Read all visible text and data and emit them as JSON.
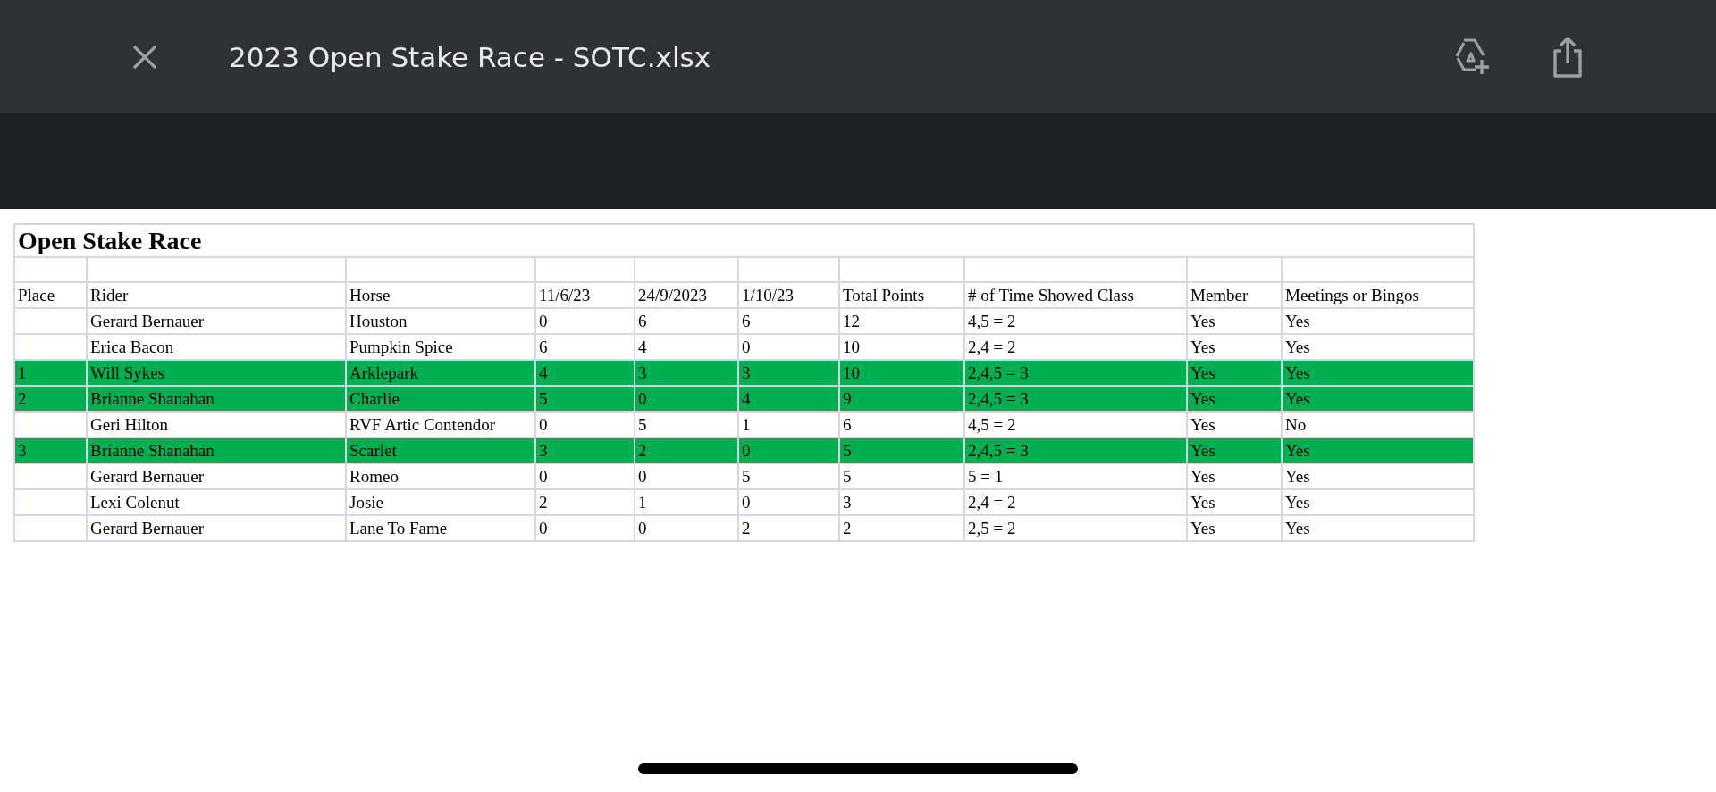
{
  "app_bar": {
    "title": "2023 Open Stake Race - SOTC.xlsx"
  },
  "sheet": {
    "title": "Open Stake Race",
    "columns": [
      "Place",
      "Rider",
      "Horse",
      "11/6/23",
      "24/9/2023",
      "1/10/23",
      "Total Points",
      "# of Time Showed Class",
      "Member",
      "Meetings or Bingos"
    ],
    "rows": [
      {
        "highlighted": false,
        "cells": [
          "",
          "Gerard Bernauer",
          "Houston",
          "0",
          "6",
          "6",
          "12",
          "4,5 = 2",
          "Yes",
          "Yes"
        ]
      },
      {
        "highlighted": false,
        "cells": [
          "",
          "Erica Bacon",
          "Pumpkin Spice",
          "6",
          "4",
          "0",
          "10",
          "2,4 = 2",
          "Yes",
          "Yes"
        ]
      },
      {
        "highlighted": true,
        "cells": [
          "1",
          "Will Sykes",
          "Arklepark",
          "4",
          "3",
          "3",
          "10",
          "2,4,5 = 3",
          "Yes",
          "Yes"
        ]
      },
      {
        "highlighted": true,
        "cells": [
          "2",
          "Brianne Shanahan",
          "Charlie",
          "5",
          "0",
          "4",
          "9",
          "2,4,5 = 3",
          "Yes",
          "Yes"
        ]
      },
      {
        "highlighted": false,
        "cells": [
          "",
          "Geri Hilton",
          "RVF Artic Contendor",
          "0",
          "5",
          "1",
          "6",
          "4,5 = 2",
          "Yes",
          "No"
        ]
      },
      {
        "highlighted": true,
        "cells": [
          "3",
          "Brianne Shanahan",
          "Scarlet",
          "3",
          "2",
          "0",
          "5",
          "2,4,5 = 3",
          "Yes",
          "Yes"
        ]
      },
      {
        "highlighted": false,
        "cells": [
          "",
          "Gerard Bernauer",
          "Romeo",
          "0",
          "0",
          "5",
          "5",
          "5 = 1",
          "Yes",
          "Yes"
        ]
      },
      {
        "highlighted": false,
        "cells": [
          "",
          "Lexi Colenut",
          "Josie",
          "2",
          "1",
          "0",
          "3",
          "2,4 = 2",
          "Yes",
          "Yes"
        ]
      },
      {
        "highlighted": false,
        "cells": [
          "",
          "Gerard Bernauer",
          "Lane To Fame",
          "0",
          "0",
          "2",
          "2",
          "2,5 = 2",
          "Yes",
          "Yes"
        ]
      }
    ]
  }
}
